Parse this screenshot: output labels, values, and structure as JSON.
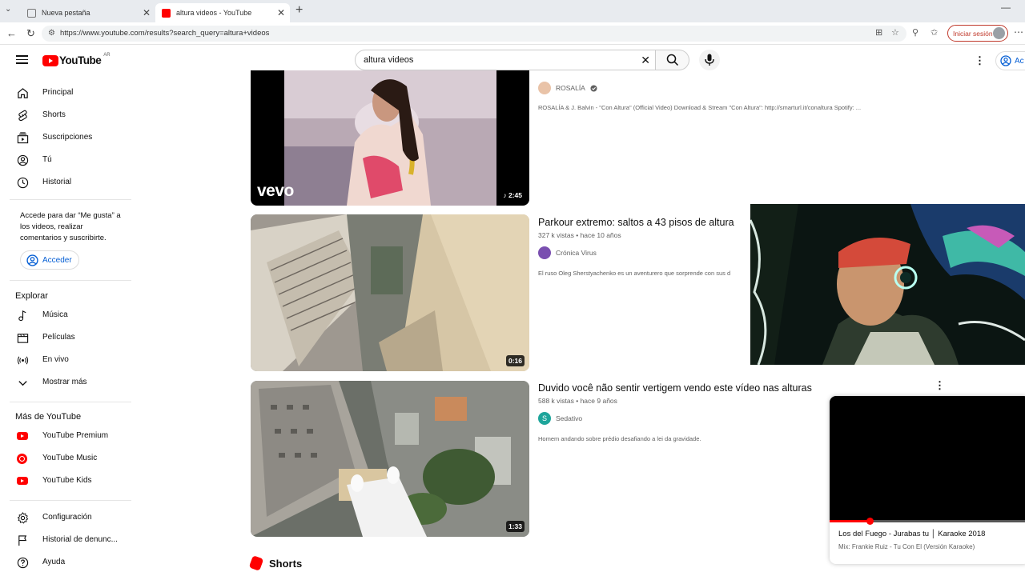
{
  "browser": {
    "tabs": [
      {
        "title": "Nueva pestaña",
        "active": false
      },
      {
        "title": "altura videos - YouTube",
        "active": true
      }
    ],
    "url": "https://www.youtube.com/results?search_query=altura+videos",
    "signin_label": "Iniciar sesión"
  },
  "header": {
    "logo_text": "YouTube",
    "country_code": "AR",
    "search_value": "altura videos",
    "account_label": "Ac"
  },
  "sidebar": {
    "main_items": [
      {
        "label": "Principal",
        "icon": "home-icon"
      },
      {
        "label": "Shorts",
        "icon": "shorts-icon"
      },
      {
        "label": "Suscripciones",
        "icon": "subscriptions-icon"
      },
      {
        "label": "Tú",
        "icon": "you-icon"
      },
      {
        "label": "Historial",
        "icon": "history-icon"
      }
    ],
    "signin_note": "Accede para dar “Me gusta” a los videos, realizar comentarios y suscribirte.",
    "signin_button": "Acceder",
    "explore_heading": "Explorar",
    "explore_items": [
      {
        "label": "Música",
        "icon": "music-icon"
      },
      {
        "label": "Películas",
        "icon": "movies-icon"
      },
      {
        "label": "En vivo",
        "icon": "live-icon"
      },
      {
        "label": "Mostrar más",
        "icon": "chevron-down-icon"
      }
    ],
    "more_heading": "Más de YouTube",
    "more_items": [
      {
        "label": "YouTube Premium",
        "icon": "youtube-premium-icon"
      },
      {
        "label": "YouTube Music",
        "icon": "youtube-music-icon"
      },
      {
        "label": "YouTube Kids",
        "icon": "youtube-kids-icon"
      }
    ],
    "settings_items": [
      {
        "label": "Configuración",
        "icon": "gear-icon"
      },
      {
        "label": "Historial de denunc...",
        "icon": "flag-icon"
      },
      {
        "label": "Ayuda",
        "icon": "help-icon"
      }
    ]
  },
  "results": [
    {
      "title": "",
      "meta": "",
      "channel": "ROSALÍA",
      "verified": true,
      "description": "ROSALÍA & J. Balvin - \"Con Altura\" (Official Video) Download & Stream \"Con Altura\": http://smarturl.it/conaltura Spotify: ...",
      "duration": "2:45",
      "badge": "vevo"
    },
    {
      "title": "Parkour extremo: saltos a 43 pisos de altura",
      "meta": "327 k vistas • hace 10 años",
      "channel": "Crónica Virus",
      "description": "El ruso Oleg Sherstyachenko es un aventurero que sorprende con sus d",
      "duration": "0:16"
    },
    {
      "title": "Duvido você não sentir vertigem vendo este vídeo nas alturas",
      "meta": "588 k vistas • hace 9 años",
      "channel": "Sedativo",
      "channel_initial": "S",
      "description": "Homem andando sobre prédio desafiando a lei da gravidade.",
      "duration": "1:33"
    }
  ],
  "shorts_heading": "Shorts",
  "miniplayer": {
    "title": "Los del Fuego - Jurabas tu │ Karaoke 2018",
    "subtitle": "Mix: Frankie Ruiz - Tu Con El (Versión Karaoke)",
    "progress": 0.2
  },
  "colors": {
    "brand_red": "#ff0000",
    "link_blue": "#065fd4"
  }
}
